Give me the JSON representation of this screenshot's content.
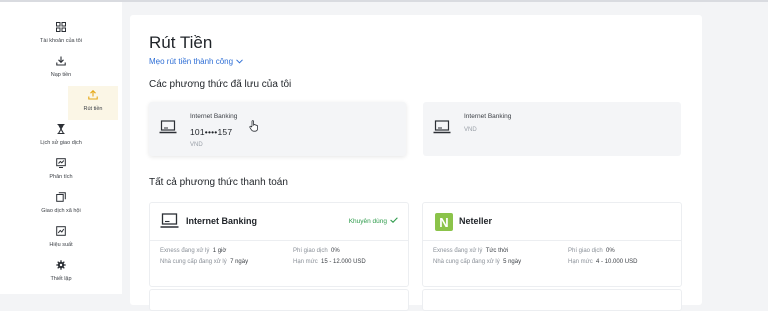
{
  "sidebar": {
    "items": [
      {
        "label": "Tài khoản của tôi",
        "icon": "grid-icon"
      },
      {
        "label": "Nạp tiền",
        "icon": "download-icon"
      },
      {
        "label": "Rút tiền",
        "icon": "upload-icon",
        "active": true
      },
      {
        "label": "Lịch sử giao dịch",
        "icon": "hourglass-icon"
      },
      {
        "label": "Phân tích",
        "icon": "chart-icon"
      },
      {
        "label": "Giao dịch xã hội",
        "icon": "copy-icon"
      },
      {
        "label": "Hiệu suất",
        "icon": "performance-icon"
      },
      {
        "label": "Thiết lập",
        "icon": "gear-icon"
      }
    ]
  },
  "page": {
    "title": "Rút Tiền",
    "tips": "Mẹo rút tiền thành công",
    "saved_heading": "Các phương thức đã lưu của tôi",
    "all_heading": "Tất cả phương thức thanh toán"
  },
  "saved_methods": [
    {
      "name": "Internet Banking",
      "number": "101••••157",
      "currency": "VND"
    },
    {
      "name": "Internet Banking",
      "currency": "VND"
    }
  ],
  "payment_methods": [
    {
      "name": "Internet Banking",
      "recommended": "Khuyên dùng",
      "processing_label": "Exness đang xử lý",
      "processing_value": "1 giờ",
      "fee_label": "Phí giao dịch",
      "fee_value": "0%",
      "provider_label": "Nhà cung cấp đang xử lý",
      "provider_value": "7 ngày",
      "limit_label": "Hạn mức",
      "limit_value": "15 - 12.000 USD"
    },
    {
      "name": "Neteller",
      "logo_letter": "N",
      "processing_label": "Exness đang xử lý",
      "processing_value": "Tức thời",
      "fee_label": "Phí giao dịch",
      "fee_value": "0%",
      "provider_label": "Nhà cung cấp đang xử lý",
      "provider_value": "5 ngày",
      "limit_label": "Hạn mức",
      "limit_value": "4 - 10.000 USD"
    }
  ],
  "colors": {
    "accent": "#2f6fd6",
    "recommended": "#2e9b4b",
    "active_bg": "#fbf6e6",
    "active_icon": "#e6a817",
    "neteller": "#8bc34a"
  }
}
